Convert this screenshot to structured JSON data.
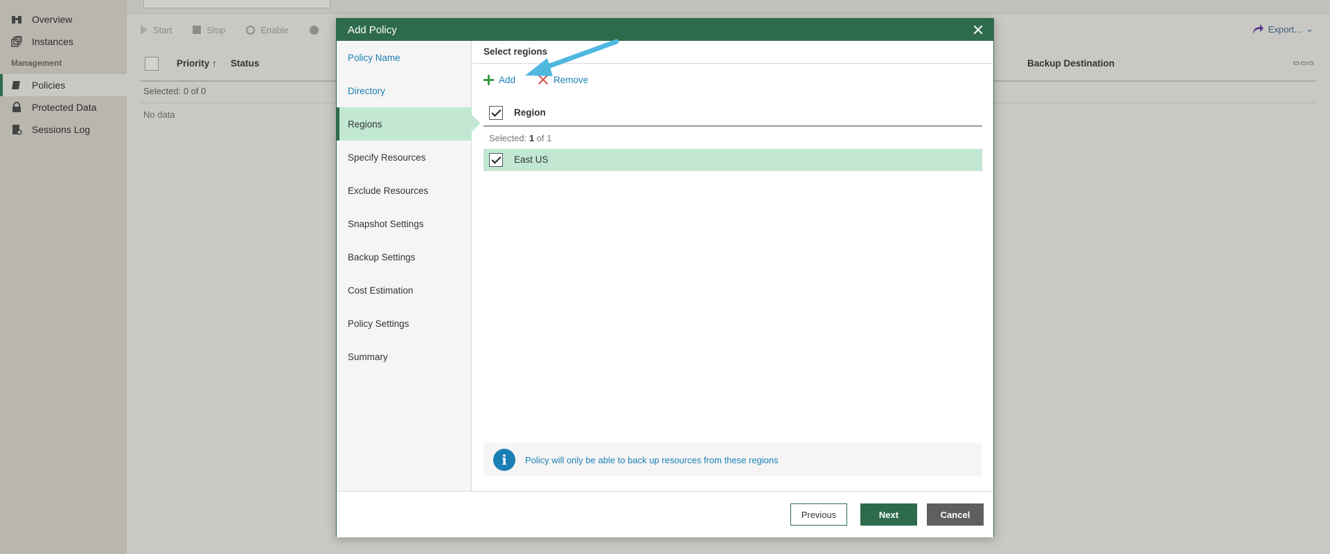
{
  "sidebar": {
    "items": [
      {
        "label": "Overview",
        "icon": "binoculars-icon"
      },
      {
        "label": "Instances",
        "icon": "instances-icon"
      },
      {
        "label": "Policies",
        "icon": "policy-icon"
      },
      {
        "label": "Protected Data",
        "icon": "lock-icon"
      },
      {
        "label": "Sessions Log",
        "icon": "log-icon"
      }
    ],
    "section_management": "Management"
  },
  "toolbar": {
    "start_label": "Start",
    "stop_label": "Stop",
    "enable_label": "Enable",
    "export_label": "Export..."
  },
  "table": {
    "col_priority": "Priority",
    "col_status": "Status",
    "col_backup_destination": "Backup Destination",
    "selected_text": "Selected:  0 of 0",
    "empty_text": "No data"
  },
  "modal": {
    "title": "Add Policy",
    "steps": [
      "Policy Name",
      "Directory",
      "Regions",
      "Specify Resources",
      "Exclude Resources",
      "Snapshot Settings",
      "Backup Settings",
      "Cost Estimation",
      "Policy Settings",
      "Summary"
    ],
    "active_step_index": 2,
    "section_title": "Select regions",
    "add_label": "Add",
    "remove_label": "Remove",
    "grid": {
      "column": "Region",
      "selected_prefix": "Selected:",
      "selected_count": "1",
      "selected_suffix": "of 1",
      "rows": [
        {
          "region": "East US",
          "checked": true
        }
      ]
    },
    "info_text": "Policy will only be able to back up resources from these regions",
    "buttons": {
      "previous": "Previous",
      "next": "Next",
      "cancel": "Cancel"
    }
  },
  "colors": {
    "accent": "#2e6b4c",
    "link": "#1a7fb4",
    "selection": "#c2e8d4",
    "annotation_arrow": "#4fb8e0"
  }
}
